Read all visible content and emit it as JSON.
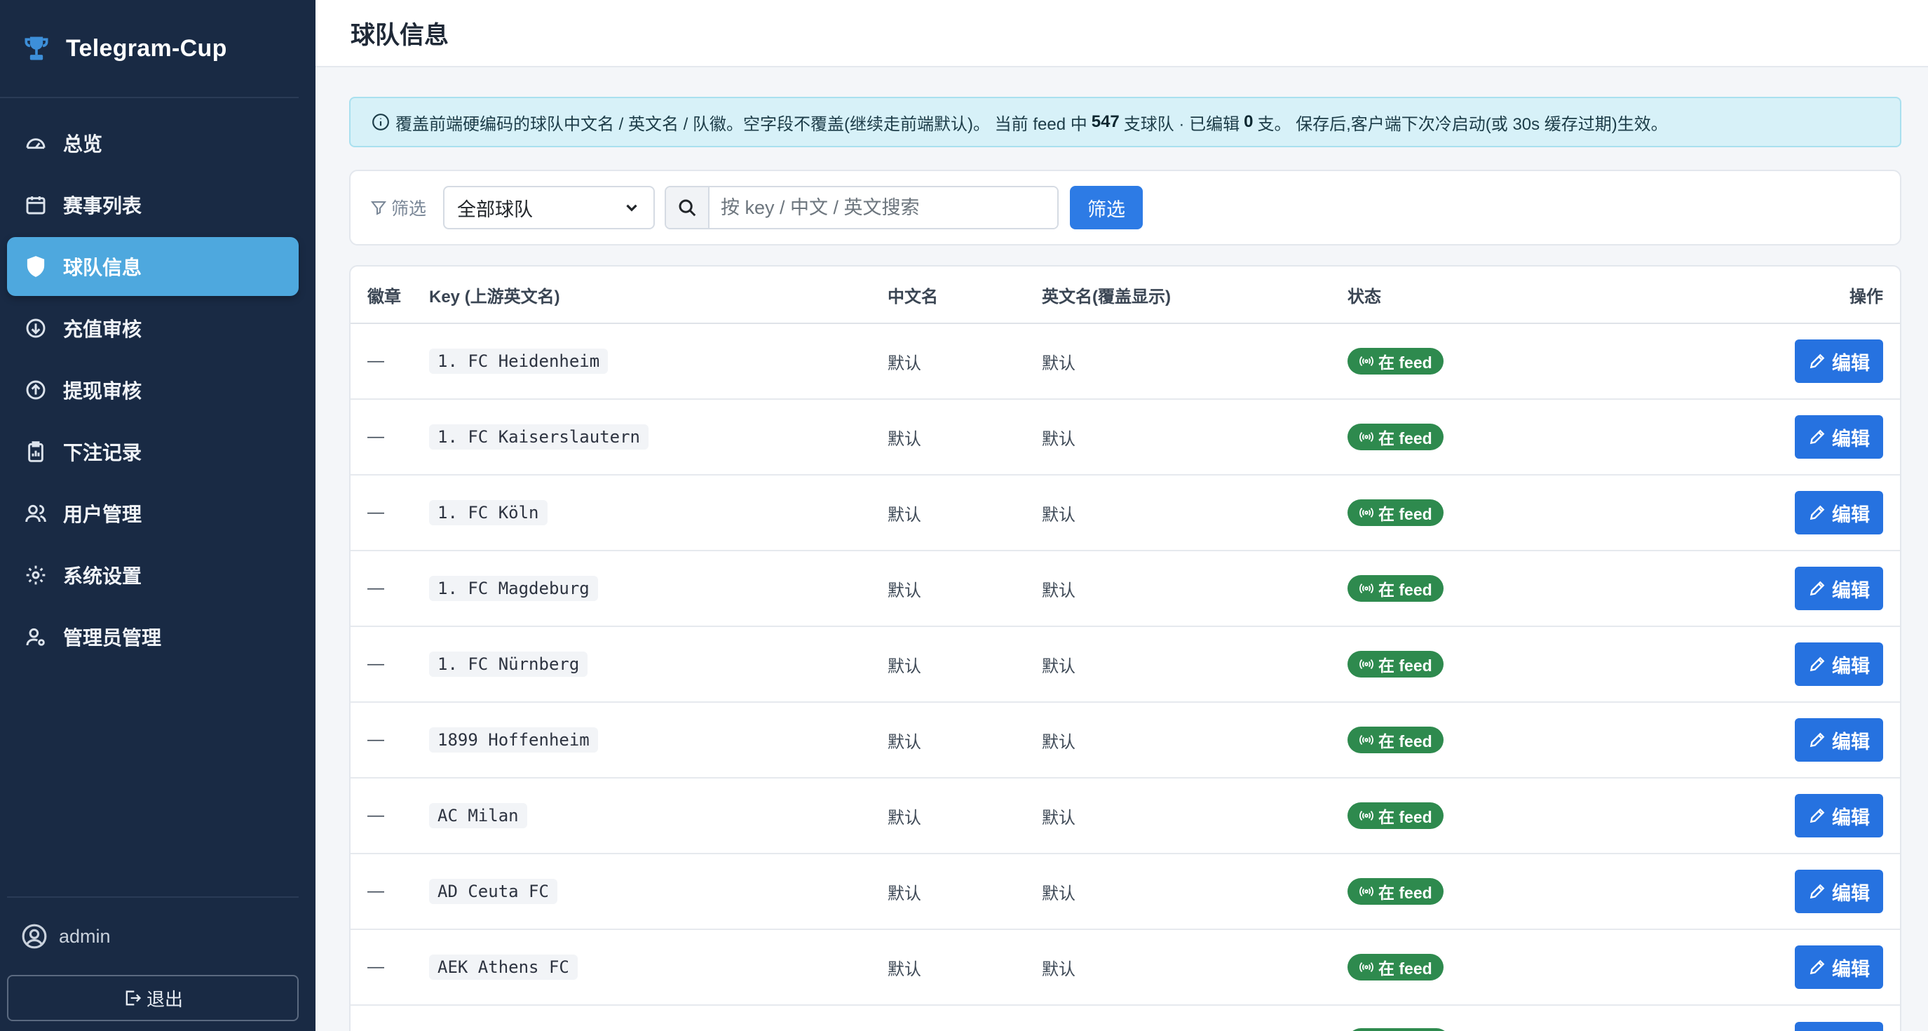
{
  "app": {
    "brand": "Telegram-Cup"
  },
  "sidebar": {
    "items": [
      {
        "label": "总览",
        "icon": "dashboard-icon"
      },
      {
        "label": "赛事列表",
        "icon": "calendar-icon"
      },
      {
        "label": "球队信息",
        "icon": "shield-icon",
        "active": true
      },
      {
        "label": "充值审核",
        "icon": "arrow-down-circle-icon"
      },
      {
        "label": "提现审核",
        "icon": "arrow-up-circle-icon"
      },
      {
        "label": "下注记录",
        "icon": "clipboard-chart-icon"
      },
      {
        "label": "用户管理",
        "icon": "users-icon"
      },
      {
        "label": "系统设置",
        "icon": "gear-icon"
      },
      {
        "label": "管理员管理",
        "icon": "admin-icon"
      }
    ],
    "user": "admin",
    "logout": "退出"
  },
  "page": {
    "title": "球队信息"
  },
  "notice": {
    "text_before": "覆盖前端硬编码的球队中文名 / 英文名 / 队徽。空字段不覆盖(继续走前端默认)。 当前 feed 中",
    "feed_count": "547",
    "text_mid": "支球队 · 已编辑",
    "edited_count": "0",
    "text_after": "支。 保存后,客户端下次冷启动(或 30s 缓存过期)生效。"
  },
  "filter": {
    "label": "筛选",
    "select_value": "全部球队",
    "search_placeholder": "按 key / 中文 / 英文搜索",
    "button": "筛选"
  },
  "table": {
    "headers": {
      "badge": "徽章",
      "key": "Key (上游英文名)",
      "cn": "中文名",
      "en": "英文名(覆盖显示)",
      "status": "状态",
      "ops": "操作"
    },
    "rows": [
      {
        "badge": "—",
        "key": "1. FC Heidenheim",
        "cn": "默认",
        "en": "默认",
        "status": "在 feed",
        "action": "编辑"
      },
      {
        "badge": "—",
        "key": "1. FC Kaiserslautern",
        "cn": "默认",
        "en": "默认",
        "status": "在 feed",
        "action": "编辑"
      },
      {
        "badge": "—",
        "key": "1. FC Köln",
        "cn": "默认",
        "en": "默认",
        "status": "在 feed",
        "action": "编辑"
      },
      {
        "badge": "—",
        "key": "1. FC Magdeburg",
        "cn": "默认",
        "en": "默认",
        "status": "在 feed",
        "action": "编辑"
      },
      {
        "badge": "—",
        "key": "1. FC Nürnberg",
        "cn": "默认",
        "en": "默认",
        "status": "在 feed",
        "action": "编辑"
      },
      {
        "badge": "—",
        "key": "1899 Hoffenheim",
        "cn": "默认",
        "en": "默认",
        "status": "在 feed",
        "action": "编辑"
      },
      {
        "badge": "—",
        "key": "AC Milan",
        "cn": "默认",
        "en": "默认",
        "status": "在 feed",
        "action": "编辑"
      },
      {
        "badge": "—",
        "key": "AD Ceuta FC",
        "cn": "默认",
        "en": "默认",
        "status": "在 feed",
        "action": "编辑"
      },
      {
        "badge": "—",
        "key": "AEK Athens FC",
        "cn": "默认",
        "en": "默认",
        "status": "在 feed",
        "action": "编辑"
      }
    ]
  },
  "colors": {
    "sidebar_bg": "#192a44",
    "active_nav": "#4ea8de",
    "primary_button": "#2672e0",
    "status_green": "#2e8a4e",
    "alert_bg": "#d7f1f8"
  }
}
